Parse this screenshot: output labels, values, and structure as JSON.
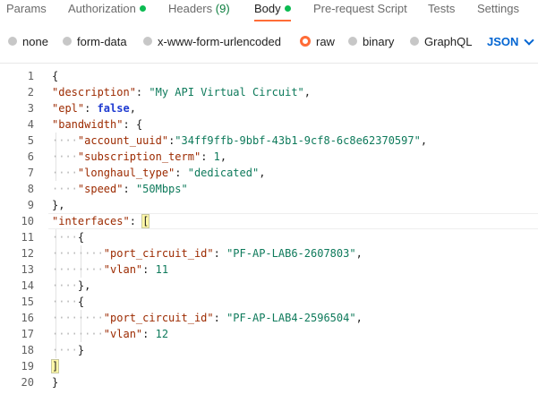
{
  "tabs": {
    "params": "Params",
    "authorization": "Authorization",
    "headers": "Headers",
    "headers_count": "(9)",
    "body": "Body",
    "pre_request": "Pre-request Script",
    "tests": "Tests",
    "settings": "Settings"
  },
  "body_options": {
    "none": "none",
    "form_data": "form-data",
    "urlencoded": "x-www-form-urlencoded",
    "raw": "raw",
    "binary": "binary",
    "graphql": "GraphQL",
    "language": "JSON",
    "selected": "raw"
  },
  "editor": {
    "lines": [
      "1",
      "2",
      "3",
      "4",
      "5",
      "6",
      "7",
      "8",
      "9",
      "10",
      "11",
      "12",
      "13",
      "14",
      "15",
      "16",
      "17",
      "18",
      "19",
      "20"
    ],
    "t": {
      "brace_open": "{",
      "brace_close": "}",
      "k_description": "\"description\"",
      "v_description": "\"My API Virtual Circuit\"",
      "k_epl": "\"epl\"",
      "v_epl": "false",
      "k_bandwidth": "\"bandwidth\"",
      "k_account_uuid": "\"account_uuid\"",
      "v_account_uuid": "\"34ff9ffb-9bbf-43b1-9cf8-6c8e62370597\"",
      "k_subscription_term": "\"subscription_term\"",
      "v_subscription_term": "1",
      "k_longhaul_type": "\"longhaul_type\"",
      "v_longhaul_type": "\"dedicated\"",
      "k_speed": "\"speed\"",
      "v_speed": "\"50Mbps\"",
      "close_obj_comma": "},",
      "k_interfaces": "\"interfaces\"",
      "bracket_open": "[",
      "bracket_close": "]",
      "k_port_circuit_id": "\"port_circuit_id\"",
      "v_port_1": "\"PF-AP-LAB6-2607803\"",
      "k_vlan": "\"vlan\"",
      "v_vlan_1": "11",
      "v_port_2": "\"PF-AP-LAB4-2596504\"",
      "v_vlan_2": "12"
    }
  },
  "colors": {
    "accent": "#ff6c37",
    "status_dot": "#0cbb52",
    "key": "#9c2a00",
    "string": "#0e7a5b",
    "boolean": "#1f3bd1",
    "language": "#0265d2"
  }
}
